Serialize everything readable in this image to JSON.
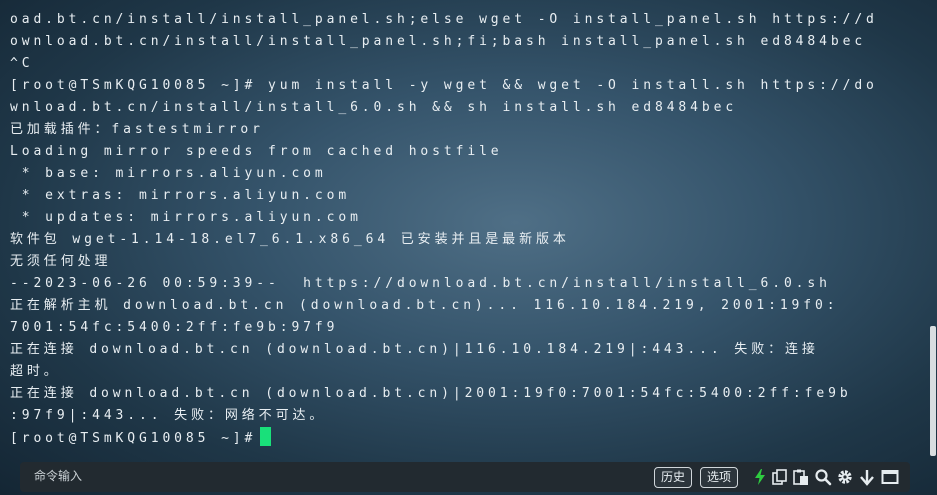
{
  "terminal": {
    "lines": [
      "oad.bt.cn/install/install_panel.sh;else wget -O install_panel.sh https://d",
      "ownload.bt.cn/install/install_panel.sh;fi;bash install_panel.sh ed8484bec",
      "^C",
      "[root@TSmKQG10085 ~]# yum install -y wget && wget -O install.sh https://do",
      "wnload.bt.cn/install/install_6.0.sh && sh install.sh ed8484bec",
      "已加载插件：fastestmirror",
      "Loading mirror speeds from cached hostfile",
      " * base: mirrors.aliyun.com",
      " * extras: mirrors.aliyun.com",
      " * updates: mirrors.aliyun.com",
      "软件包 wget-1.14-18.el7_6.1.x86_64 已安装并且是最新版本",
      "无须任何处理",
      "--2023-06-26 00:59:39--  https://download.bt.cn/install/install_6.0.sh",
      "正在解析主机 download.bt.cn (download.bt.cn)... 116.10.184.219, 2001:19f0:",
      "7001:54fc:5400:2ff:fe9b:97f9",
      "正在连接 download.bt.cn (download.bt.cn)|116.10.184.219|:443... 失败：连接",
      "超时。",
      "正在连接 download.bt.cn (download.bt.cn)|2001:19f0:7001:54fc:5400:2ff:fe9b",
      ":97f9|:443... 失败：网络不可达。"
    ],
    "prompt": "[root@TSmKQG10085 ~]#"
  },
  "command_bar": {
    "input_label": "命令输入",
    "history_button": "历史",
    "options_button": "选项"
  },
  "colors": {
    "cursor": "#19e07a",
    "lightning": "#2ecc40"
  },
  "icons": [
    "lightning-icon",
    "copy-icon",
    "paste-icon",
    "search-icon",
    "gear-icon",
    "download-arrow-icon",
    "window-icon"
  ]
}
